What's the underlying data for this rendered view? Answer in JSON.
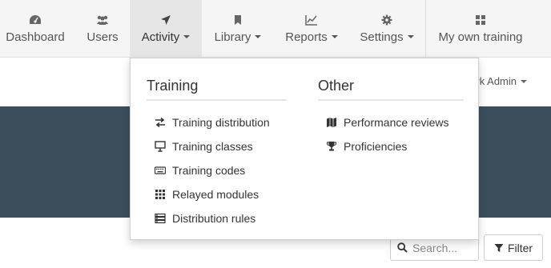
{
  "nav": {
    "items": [
      {
        "label": "Dashboard",
        "icon": "dashboard-icon"
      },
      {
        "label": "Users",
        "icon": "users-icon"
      },
      {
        "label": "Activity",
        "icon": "location-arrow-icon",
        "active": true,
        "has_caret": true
      },
      {
        "label": "Library",
        "icon": "bookmark-icon",
        "has_caret": true
      },
      {
        "label": "Reports",
        "icon": "line-chart-icon",
        "has_caret": true
      },
      {
        "label": "Settings",
        "icon": "gear-icon",
        "has_caret": true
      },
      {
        "label": "My own training",
        "icon": "grid-icon"
      }
    ]
  },
  "user_menu": {
    "label": "rk Admin"
  },
  "dropdown": {
    "training": {
      "title": "Training",
      "items": [
        {
          "label": "Training distribution",
          "icon": "exchange-icon"
        },
        {
          "label": "Training classes",
          "icon": "presentation-icon"
        },
        {
          "label": "Training codes",
          "icon": "keyboard-icon"
        },
        {
          "label": "Relayed modules",
          "icon": "grid-dots-icon"
        },
        {
          "label": "Distribution rules",
          "icon": "list-rules-icon"
        }
      ]
    },
    "other": {
      "title": "Other",
      "items": [
        {
          "label": "Performance reviews",
          "icon": "map-icon"
        },
        {
          "label": "Proficiencies",
          "icon": "trophy-icon"
        }
      ]
    }
  },
  "search": {
    "placeholder": "Search..."
  },
  "filter": {
    "label": "Filter"
  },
  "colors": {
    "banner": "#3d4e5c",
    "nav_bg": "#f5f5f5",
    "nav_active": "#e6e6e6"
  }
}
